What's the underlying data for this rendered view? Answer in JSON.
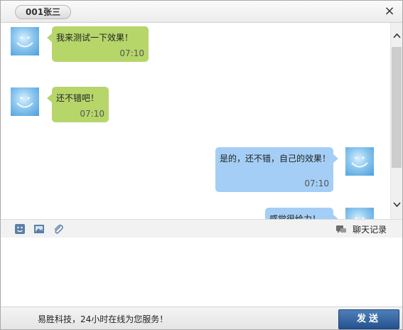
{
  "window": {
    "title": "001张三",
    "close_icon": "close-icon",
    "close_glyph": "×"
  },
  "messages": [
    {
      "side": "left",
      "text": "我来测试一下效果！",
      "time": "07:10"
    },
    {
      "side": "left",
      "text": "还不错吧！",
      "time": "07:10"
    },
    {
      "side": "right",
      "text": "是的，还不错，自己的效果！",
      "time": "07:10"
    },
    {
      "side": "right",
      "text": "感觉很给力！",
      "time": ""
    }
  ],
  "scrollbar": {
    "up_glyph": "⌃",
    "down_glyph": "⌄"
  },
  "toolbar": {
    "icons": [
      "emoji-icon",
      "image-icon",
      "attachment-icon"
    ],
    "history_icon": "chat-history-icon",
    "history_label": "聊天记录"
  },
  "input": {
    "value": "",
    "placeholder": ""
  },
  "footer": {
    "text": "易胜科技，24小时在线为您服务！",
    "send_label": "发送"
  },
  "colors": {
    "left_bubble": "#b6d66a",
    "right_bubble": "#a4cef5",
    "send_button": "#2f5f9e"
  }
}
